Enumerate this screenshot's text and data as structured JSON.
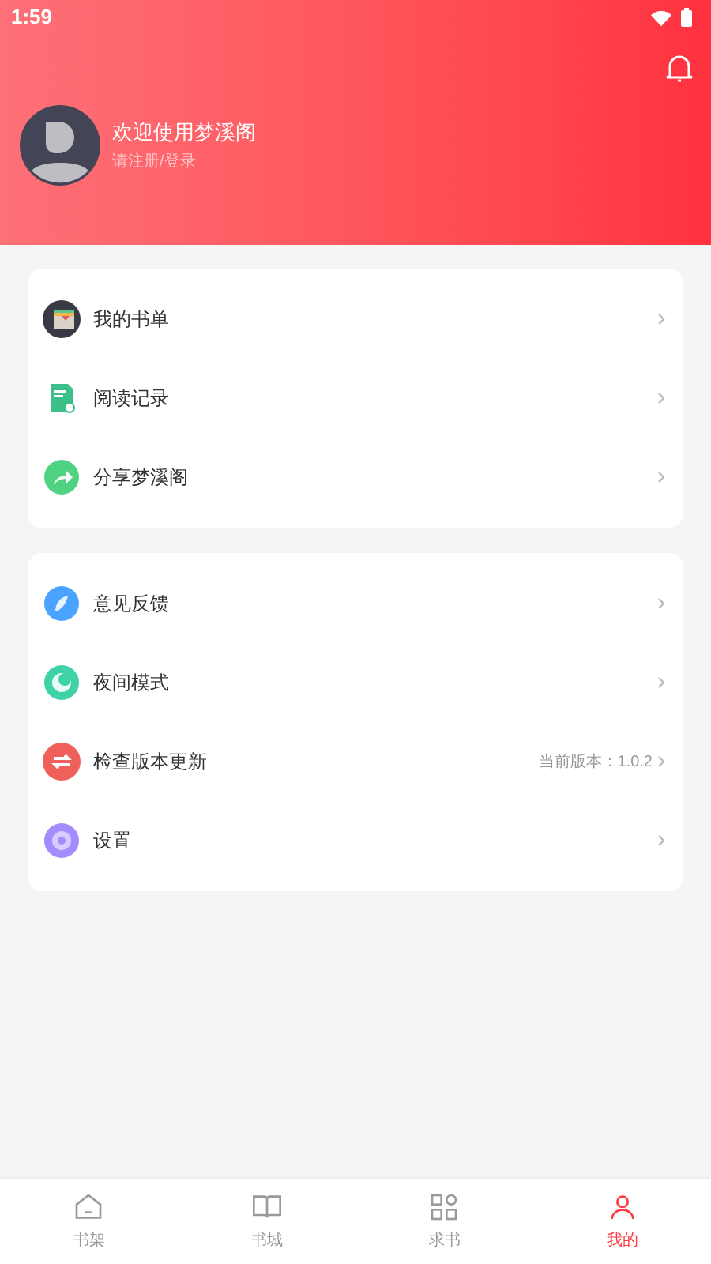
{
  "status_bar": {
    "time": "1:59"
  },
  "profile": {
    "title": "欢迎使用梦溪阁",
    "subtitle": "请注册/登录"
  },
  "menu_groups": [
    {
      "items": [
        {
          "label": "我的书单",
          "kind": "booklist"
        },
        {
          "label": "阅读记录",
          "kind": "history"
        },
        {
          "label": "分享梦溪阁",
          "kind": "share"
        }
      ]
    },
    {
      "items": [
        {
          "label": "意见反馈",
          "kind": "feedback"
        },
        {
          "label": "夜间模式",
          "kind": "night"
        },
        {
          "label": "检查版本更新",
          "kind": "update",
          "value": "当前版本：1.0.2"
        },
        {
          "label": "设置",
          "kind": "settings"
        }
      ]
    }
  ],
  "bottom_nav": [
    {
      "label": "书架",
      "kind": "home",
      "selected": false
    },
    {
      "label": "书城",
      "kind": "book",
      "selected": false
    },
    {
      "label": "求书",
      "kind": "grid",
      "selected": false
    },
    {
      "label": "我的",
      "kind": "user",
      "selected": true
    }
  ]
}
